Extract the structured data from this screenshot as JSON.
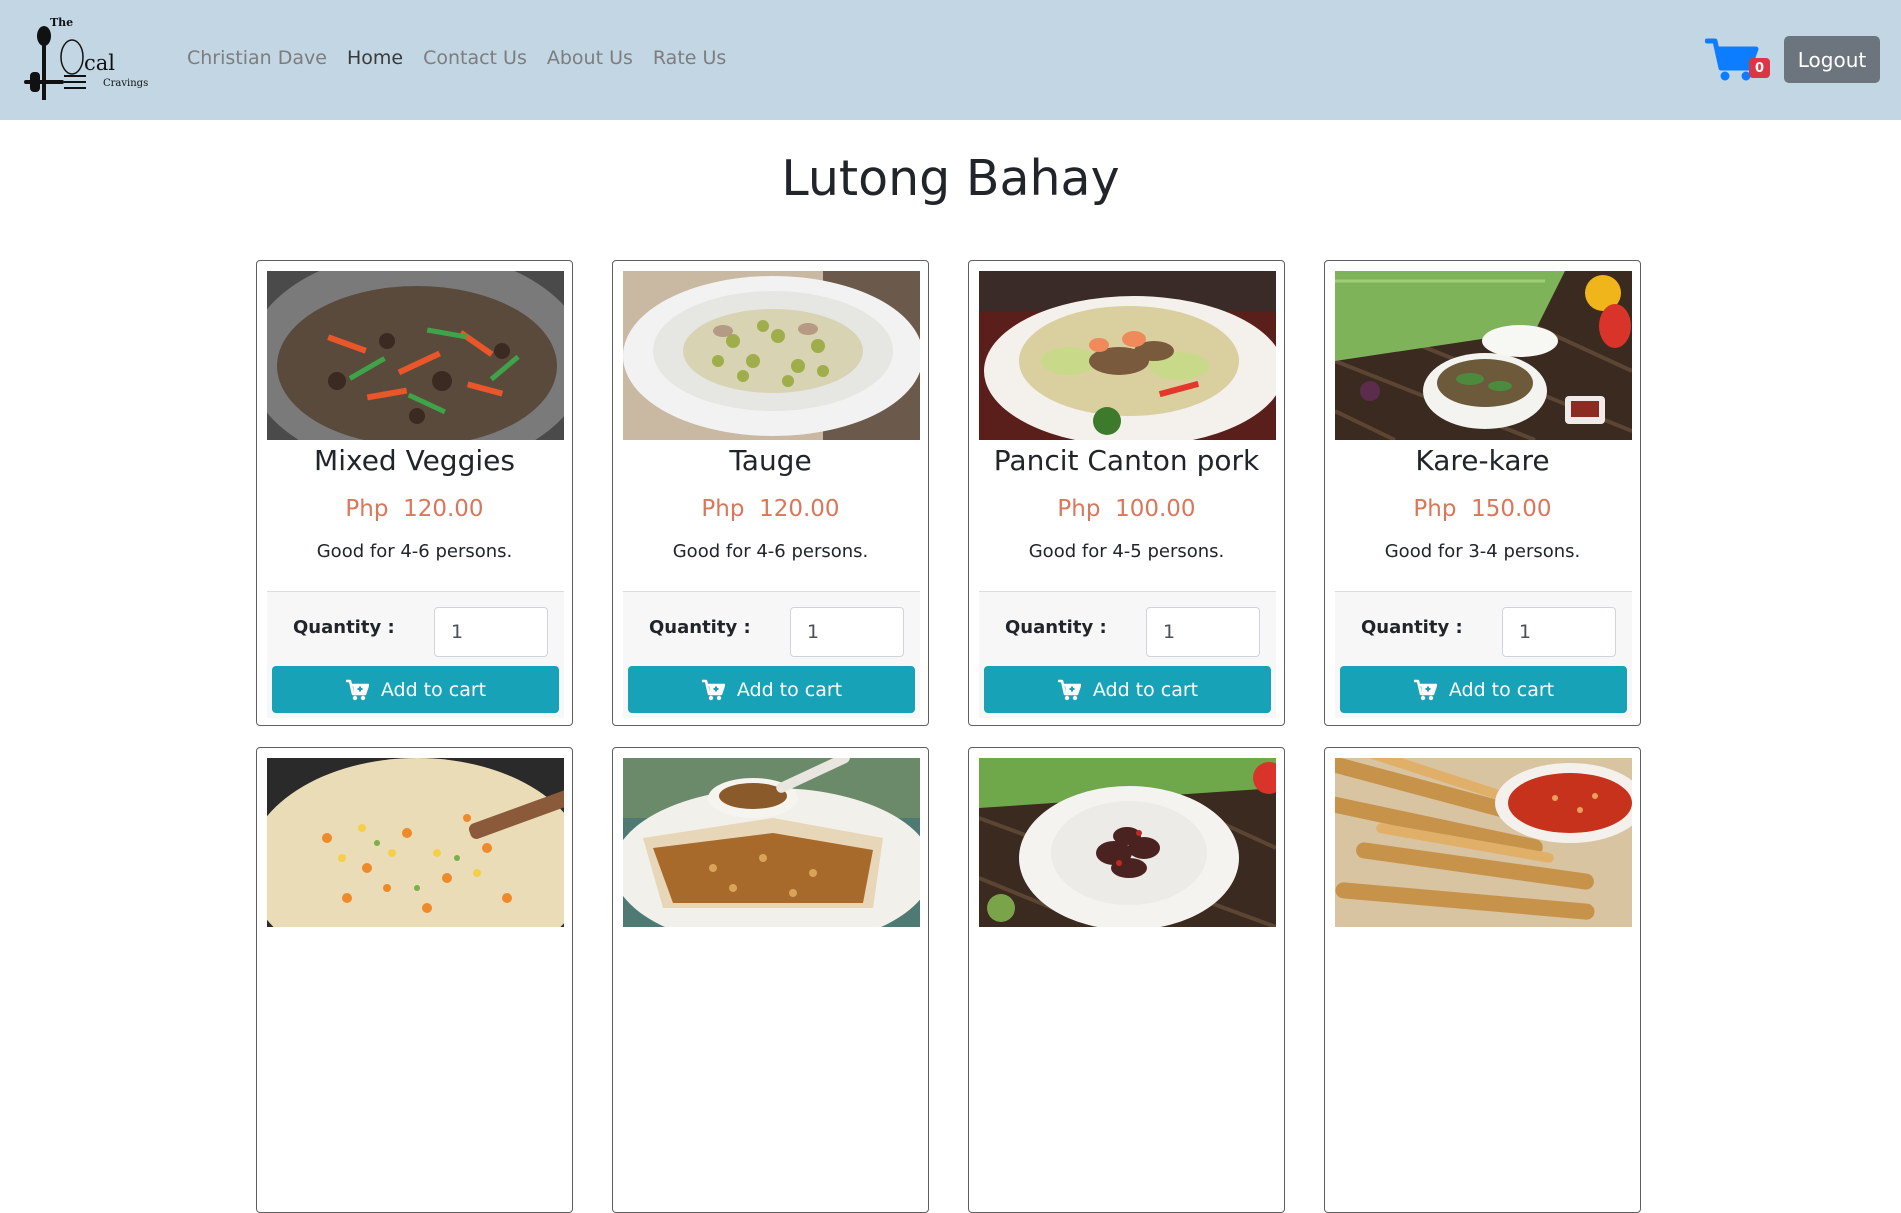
{
  "brand": {
    "logo_text_top": "The",
    "logo_text_main": "cal",
    "logo_text_sub": "Cravings"
  },
  "nav": {
    "items": [
      {
        "label": "Christian Dave",
        "active": false
      },
      {
        "label": "Home",
        "active": true
      },
      {
        "label": "Contact Us",
        "active": false
      },
      {
        "label": "About Us",
        "active": false
      },
      {
        "label": "Rate Us",
        "active": false
      }
    ],
    "cart_count": "0",
    "logout_label": "Logout"
  },
  "page": {
    "title": "Lutong Bahay"
  },
  "colors": {
    "navbar": "#c3d6e4",
    "price": "#d9775b",
    "add_button": "#17a2b8",
    "cart_icon": "#0d7dff",
    "badge": "#dc3545",
    "logout": "#6c757d"
  },
  "products": [
    {
      "name": "Mixed Veggies",
      "price": "Php  120.00",
      "desc": "Good for 4-6 persons.",
      "qty_label": "Quantity :",
      "qty": "1",
      "button": "Add to cart",
      "image": "wok-stir-fry-vegetables"
    },
    {
      "name": "Tauge",
      "price": "Php  120.00",
      "desc": "Good for 4-6 persons.",
      "qty_label": "Quantity :",
      "qty": "1",
      "button": "Add to cart",
      "image": "bean-sprouts-bowl"
    },
    {
      "name": "Pancit Canton pork",
      "price": "Php  100.00",
      "desc": "Good for 4-5 persons.",
      "qty_label": "Quantity :",
      "qty": "1",
      "button": "Add to cart",
      "image": "pancit-plate"
    },
    {
      "name": "Kare-kare",
      "price": "Php  150.00",
      "desc": "Good for 3-4 persons.",
      "qty_label": "Quantity :",
      "qty": "1",
      "button": "Add to cart",
      "image": "kare-kare-clay-pot"
    },
    {
      "image": "fried-rice-pan"
    },
    {
      "image": "lumpia-sauce-plate"
    },
    {
      "image": "beef-plate"
    },
    {
      "image": "spring-rolls-dip"
    }
  ]
}
